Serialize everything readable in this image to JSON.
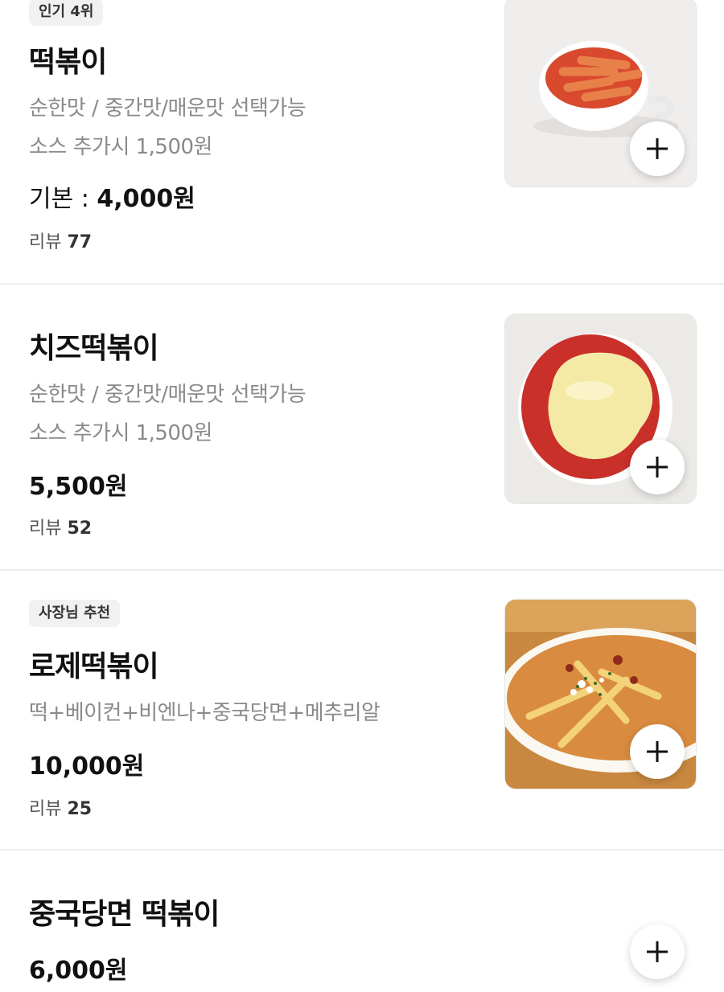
{
  "menu_items": [
    {
      "badge": "인기 4위",
      "name": "떡볶이",
      "desc_lines": [
        "순한맛 / 중간맛/매운맛 선택가능",
        "소스 추가시 1,500원"
      ],
      "price_label": "기본 : ",
      "price": "4,000원",
      "review_label": "리뷰 ",
      "review_count": "77"
    },
    {
      "name": "치즈떡볶이",
      "desc_lines": [
        "순한맛 / 중간맛/매운맛 선택가능",
        "소스 추가시 1,500원"
      ],
      "price": "5,500원",
      "review_label": "리뷰 ",
      "review_count": "52"
    },
    {
      "badge": "사장님 추천",
      "name": "로제떡볶이",
      "desc_lines": [
        "떡+베이컨+비엔나+중국당면+메추리알"
      ],
      "price": "10,000원",
      "review_label": "리뷰 ",
      "review_count": "25"
    },
    {
      "name": "중국당면 떡볶이",
      "price": "6,000원"
    }
  ],
  "icons": {
    "add": "plus-icon"
  }
}
